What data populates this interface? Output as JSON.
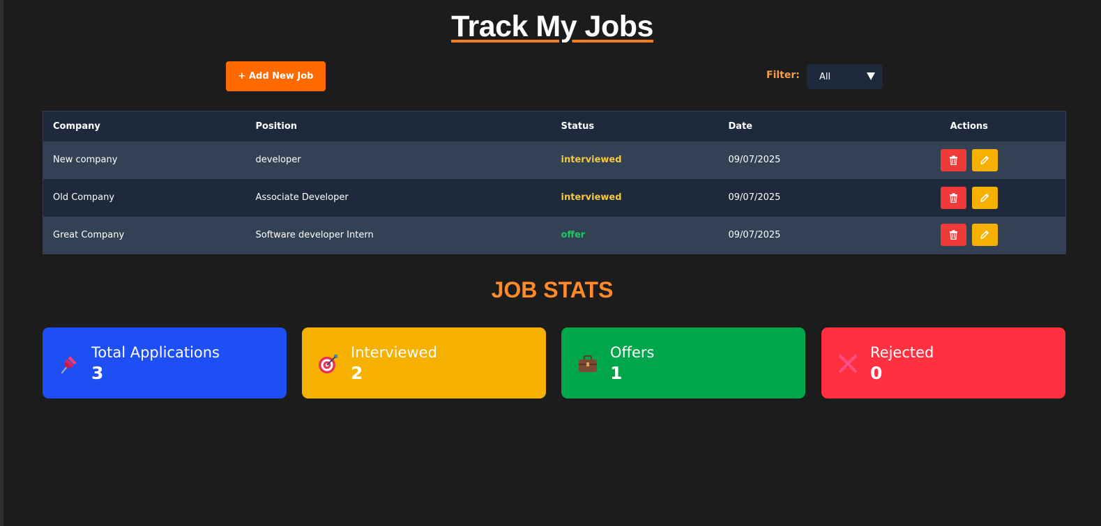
{
  "app": {
    "title": "Track My Jobs"
  },
  "toolbar": {
    "add_label": "+ Add New Job",
    "filter_label": "Filter:",
    "filter_value": "All"
  },
  "table": {
    "headers": [
      "Company",
      "Position",
      "Status",
      "Date",
      "Actions"
    ],
    "rows": [
      {
        "company": "New company",
        "position": "developer",
        "status": "interviewed",
        "date": "09/07/2025"
      },
      {
        "company": "Old Company",
        "position": "Associate Developer",
        "status": "interviewed",
        "date": "09/07/2025"
      },
      {
        "company": "Great Company",
        "position": "Software developer Intern",
        "status": "offer",
        "date": "09/07/2025"
      }
    ],
    "status_colors": {
      "interviewed": "#f5c842",
      "offer": "#22c55e"
    },
    "row_icons": {
      "delete": "trash-icon",
      "edit": "pencil-icon"
    }
  },
  "stats": {
    "title": "JOB STATS",
    "cards": [
      {
        "label": "Total Applications",
        "value": "3",
        "icon": "pushpin-icon",
        "color": "#1d4ff5"
      },
      {
        "label": "Interviewed",
        "value": "2",
        "icon": "target-icon",
        "color": "#f5b000"
      },
      {
        "label": "Offers",
        "value": "1",
        "icon": "briefcase-icon",
        "color": "#00a64a"
      },
      {
        "label": "Rejected",
        "value": "0",
        "icon": "cross-icon",
        "color": "#ff3040"
      }
    ]
  }
}
